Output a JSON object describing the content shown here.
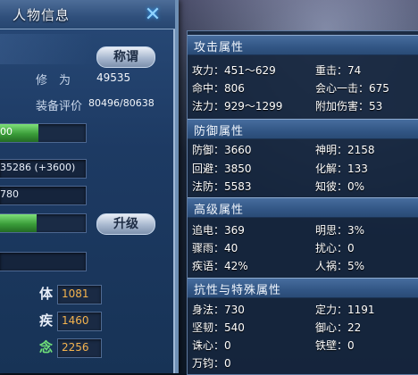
{
  "window": {
    "title": "人物信息",
    "close_glyph": "✕"
  },
  "profile": {
    "title_button": "称谓",
    "cultivation_label": "修　为",
    "cultivation_value": "49535",
    "equip_rating_label": "装备评价",
    "equip_rating_value": "80496/80638"
  },
  "bars": {
    "bar1_text": "00",
    "bar1_fill_fraction": 0.45,
    "field1_text": "35286 (+3600)",
    "field2_text": "780",
    "bar2_fill_fraction": 0.43,
    "upgrade_button": "升级"
  },
  "attributes": [
    {
      "label": "体",
      "value": "1081",
      "label_color": "#e8eef8"
    },
    {
      "label": "疾",
      "value": "1460",
      "label_color": "#e8eef8"
    },
    {
      "label": "念",
      "value": "2256",
      "label_color": "#6fe07a"
    }
  ],
  "stats": {
    "attack": {
      "header": "攻击属性",
      "items": [
        {
          "text": "攻力：451～629"
        },
        {
          "text": "重击：74"
        },
        {
          "text": "命中：806"
        },
        {
          "text": "会心一击：675"
        },
        {
          "text": "法力：929～1299"
        },
        {
          "text": "附加伤害：53"
        }
      ]
    },
    "defense": {
      "header": "防御属性",
      "items": [
        {
          "text": "防御：3660"
        },
        {
          "text": "神明：2158"
        },
        {
          "text": "回避：3850"
        },
        {
          "text": "化解：133"
        },
        {
          "text": "法防：5583"
        },
        {
          "text": "知彼：0%"
        }
      ]
    },
    "advanced": {
      "header": "高级属性",
      "items": [
        {
          "text": "追电：369"
        },
        {
          "text": "明思：3%"
        },
        {
          "text": "骤雨：40"
        },
        {
          "text": "扰心：0"
        },
        {
          "text": "疾语：42%"
        },
        {
          "text": "人祸：5%"
        }
      ]
    },
    "resist": {
      "header": "抗性与特殊属性",
      "items": [
        {
          "text": "身法：730"
        },
        {
          "text": "定力：1191"
        },
        {
          "text": "坚韧：540"
        },
        {
          "text": "御心：22"
        },
        {
          "text": "诛心：0"
        },
        {
          "text": "铁壁：0"
        },
        {
          "text": "万钧：0"
        }
      ]
    }
  }
}
